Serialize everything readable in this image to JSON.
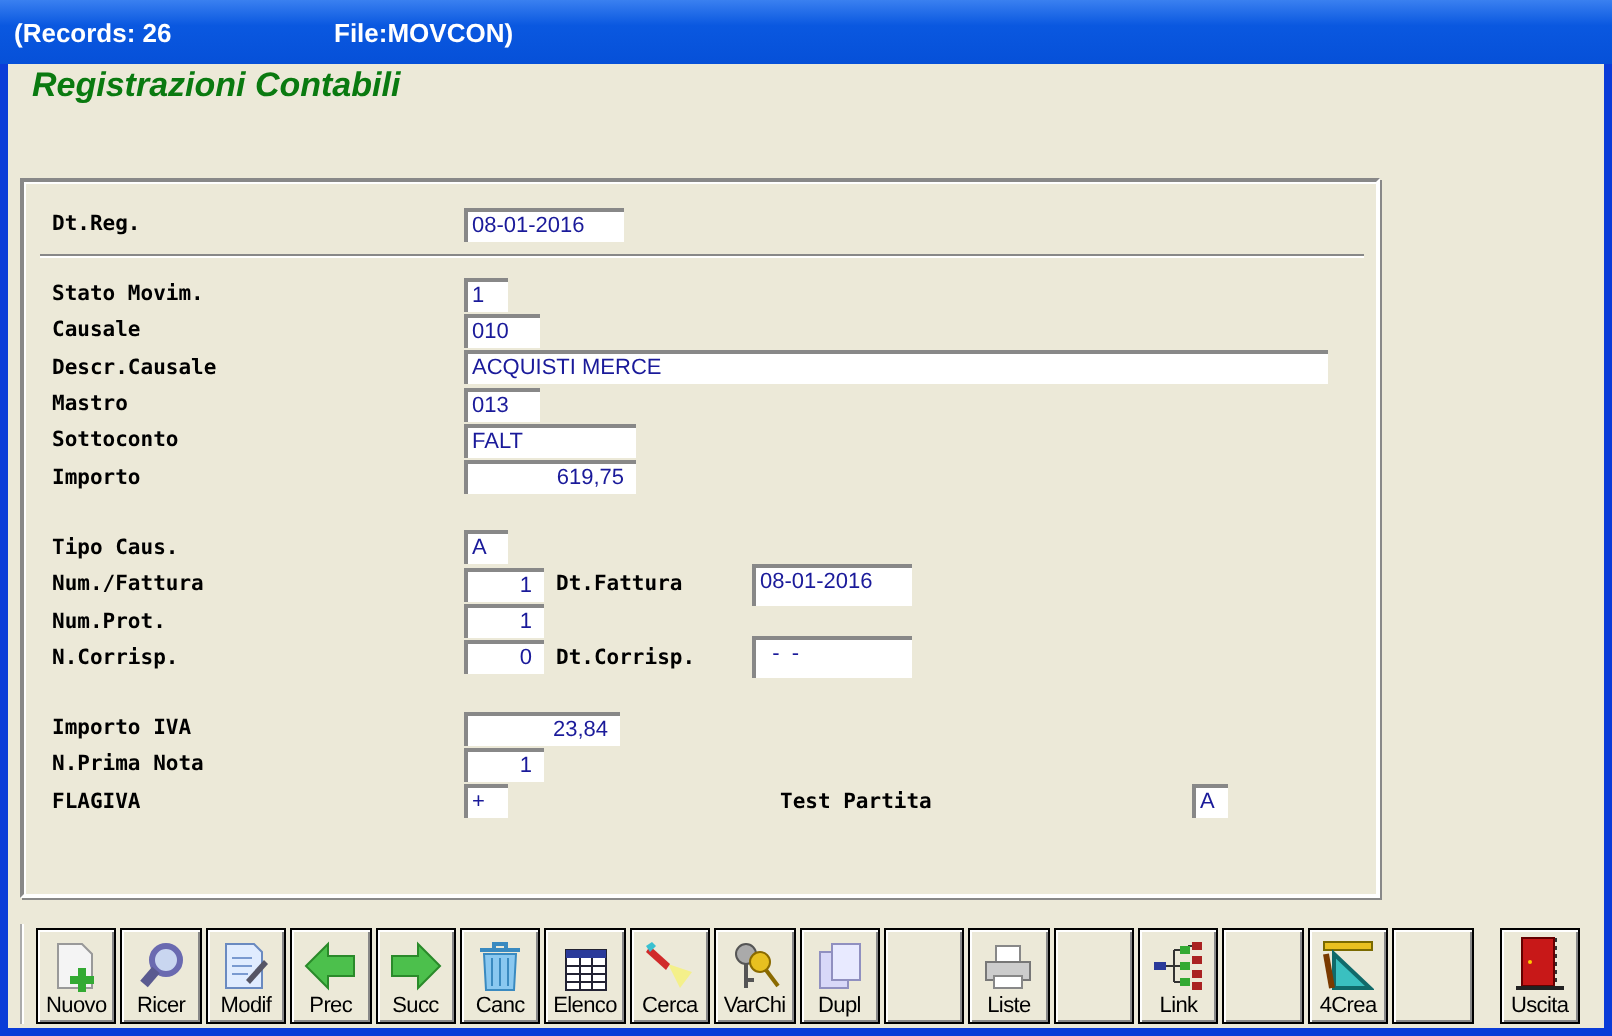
{
  "title_bar": {
    "records": "(Records: 26",
    "file": "File:MOVCON)"
  },
  "form_title": "Registrazioni Contabili",
  "header_field": {
    "label": "Dt.Reg.",
    "value": "08-01-2016"
  },
  "groups": [
    [
      {
        "label": "Stato Movim.",
        "value": "1",
        "kind": "text"
      },
      {
        "label": "Causale",
        "value": "010",
        "kind": "text"
      },
      {
        "label": "Descr.Causale",
        "value": "ACQUISTI MERCE",
        "kind": "text"
      },
      {
        "label": "Mastro",
        "value": "013",
        "kind": "text"
      },
      {
        "label": "Sottoconto",
        "value": "FALT",
        "kind": "text"
      },
      {
        "label": "Importo",
        "value": "619,75",
        "kind": "number"
      }
    ],
    [
      {
        "label": "Tipo Caus.",
        "value": "A",
        "kind": "text"
      },
      {
        "label": "Num./Fattura",
        "value": "1",
        "kind": "number",
        "extra": {
          "label": "Dt.Fattura",
          "value": "08-01-2016"
        }
      },
      {
        "label": "Num.Prot.",
        "value": "1",
        "kind": "number"
      },
      {
        "label": "N.Corrisp.",
        "value": "0",
        "kind": "number",
        "extra": {
          "label": "Dt.Corrisp.",
          "value": "  -  -"
        }
      }
    ],
    [
      {
        "label": "Importo IVA",
        "value": "23,84",
        "kind": "number"
      },
      {
        "label": "N.Prima Nota",
        "value": "1",
        "kind": "number"
      },
      {
        "label": "FLAGIVA",
        "value": "+",
        "kind": "text",
        "extra": {
          "label": "Test Partita",
          "value": "A"
        }
      }
    ]
  ],
  "toolbar": [
    {
      "kind": "button",
      "label": "Nuovo"
    },
    {
      "kind": "button",
      "label": "Ricer"
    },
    {
      "kind": "button",
      "label": "Modif"
    },
    {
      "kind": "button",
      "label": "Prec"
    },
    {
      "kind": "button",
      "label": "Succ"
    },
    {
      "kind": "button",
      "label": "Canc"
    },
    {
      "kind": "button",
      "label": "Elenco"
    },
    {
      "kind": "button",
      "label": "Cerca"
    },
    {
      "kind": "button",
      "label": "VarChi"
    },
    {
      "kind": "button",
      "label": "Dupl"
    },
    {
      "kind": "empty"
    },
    {
      "kind": "button",
      "label": "Liste"
    },
    {
      "kind": "empty"
    },
    {
      "kind": "button",
      "label": "Link"
    },
    {
      "kind": "empty"
    },
    {
      "kind": "button",
      "label": "4Crea"
    },
    {
      "kind": "empty"
    },
    {
      "kind": "button",
      "label": "Uscita"
    }
  ]
}
